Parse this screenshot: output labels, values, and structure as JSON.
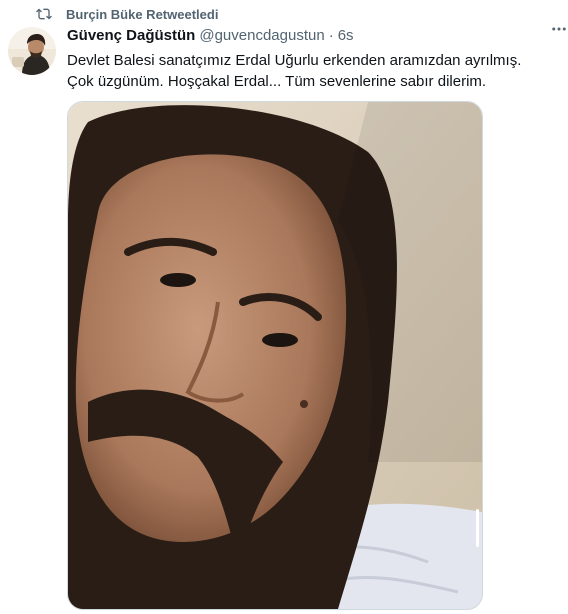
{
  "retweet": {
    "text": "Burçin Büke Retweetledi",
    "icon": "retweet-icon"
  },
  "tweet": {
    "display_name": "Güvenç Dağüstün",
    "handle": "@guvencdagustun",
    "separator": "·",
    "time": "6s",
    "text": "Devlet Balesi sanatçımız Erdal Uğurlu erkenden aramızdan ayrılmış. Çok üzgünüm. Hoşçakal Erdal... Tüm sevenlerine sabır dilerim.",
    "more_icon": "more-horizontal-icon"
  },
  "colors": {
    "text_primary": "#0f1419",
    "text_secondary": "#536471",
    "border": "#cfd9de"
  }
}
